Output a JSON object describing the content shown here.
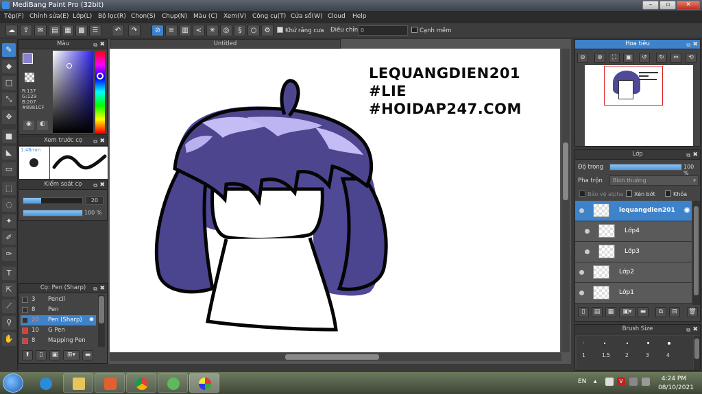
{
  "window": {
    "title": "MediBang Paint Pro (32bit)"
  },
  "menu": [
    "Tệp(F)",
    "Chỉnh sửa(E)",
    "Lớp(L)",
    "Bộ lọc(R)",
    "Chọn(S)",
    "Chụp(N)",
    "Màu (C)",
    "Xem(V)",
    "Công cụ(T)",
    "Cửa sổ(W)",
    "Cloud",
    "Help"
  ],
  "toolbar": {
    "antialias_label": "Khử răng cưa",
    "correction_label": "Điều chỉnh",
    "correction_value": "0",
    "edge_label": "Cạnh mềm"
  },
  "color_panel": {
    "title": "Màu",
    "r": "R:137",
    "g": "G:129",
    "b": "B:207",
    "hex": "#8981CF",
    "fg_color": "#8981CF"
  },
  "preview_panel": {
    "title": "Xem trước cọ",
    "size": "1.48mm"
  },
  "control_panel": {
    "title": "Kiểm soát cọ",
    "size_value": "20",
    "opacity_value": "100 %",
    "size_fill": 0.3,
    "opacity_fill": 1.0
  },
  "brush_panel": {
    "title": "Cọ: Pen (Sharp)",
    "items": [
      {
        "size": "3",
        "name": "Pencil",
        "color": "#333333"
      },
      {
        "size": "8",
        "name": "Pen",
        "color": "#333333"
      },
      {
        "size": "20",
        "name": "Pen (Sharp)",
        "color": "#333333"
      },
      {
        "size": "10",
        "name": "G Pen",
        "color": "#e03a3a"
      },
      {
        "size": "8",
        "name": "Mapping Pen",
        "color": "#e03a3a"
      }
    ]
  },
  "document": {
    "tab": "Untitled",
    "text_lines": [
      "LEQUANGDIEN201",
      "#LIE",
      "#HOIDAP247.COM"
    ]
  },
  "navigator_panel": {
    "title": "Hoa tiêu"
  },
  "layer_panel": {
    "title": "Lớp",
    "opacity_label": "Độ trong",
    "opacity_value": "100 %",
    "blend_label": "Pha trộn",
    "blend_value": "Bình thường",
    "protect_alpha": "Bảo vệ alpha",
    "clipping": "Xén bớt",
    "lock": "Khóa",
    "layers": [
      {
        "name": "lequangdien201"
      },
      {
        "name": "Lớp4"
      },
      {
        "name": "Lớp3"
      },
      {
        "name": "Lớp2"
      },
      {
        "name": "Lớp1"
      }
    ]
  },
  "brush_size_panel": {
    "title": "Brush Size",
    "sizes": [
      "1",
      "1.5",
      "2",
      "3",
      "4"
    ]
  },
  "taskbar": {
    "lang": "EN",
    "time": "4:24 PM",
    "date": "08/10/2021"
  }
}
